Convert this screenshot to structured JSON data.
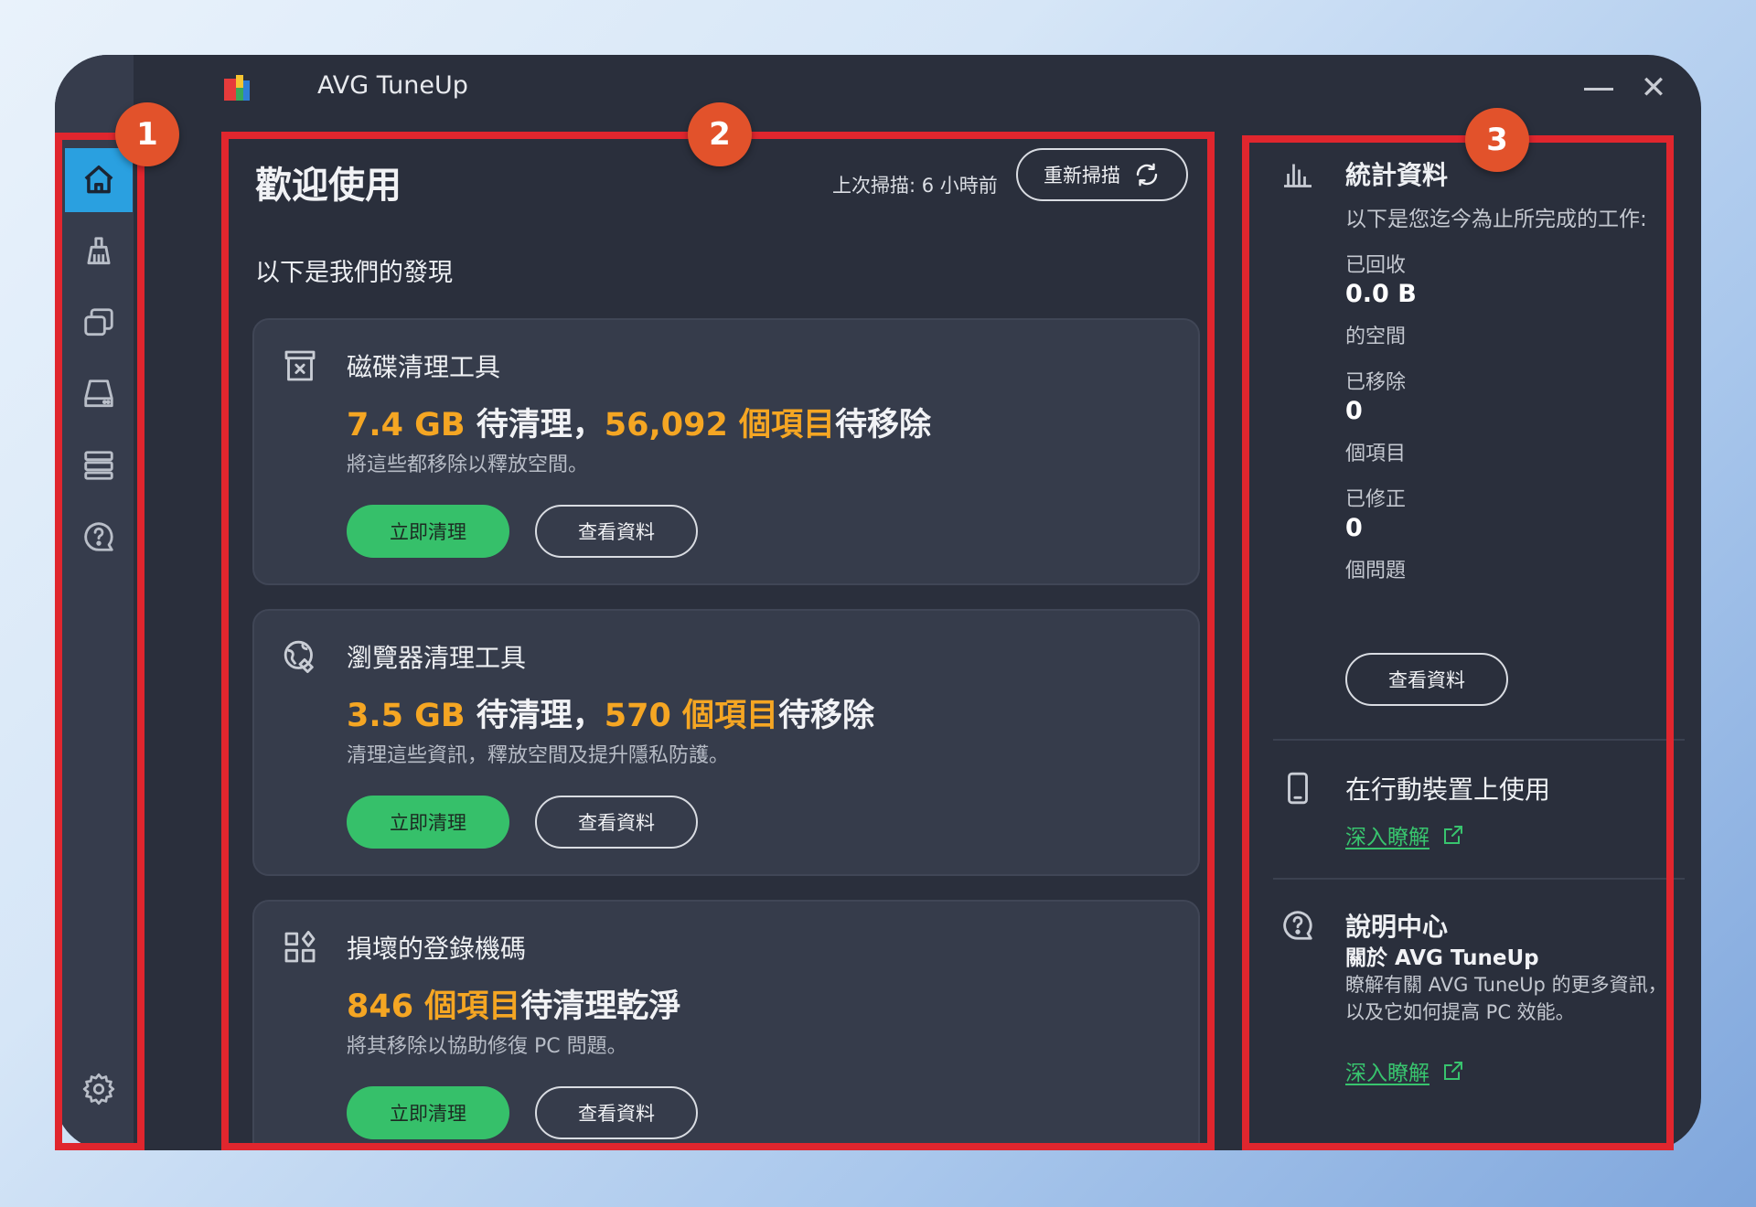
{
  "app": {
    "title": "AVG TuneUp"
  },
  "window_controls": {
    "close": "✕"
  },
  "sidebar": {
    "items": [
      {
        "name": "home",
        "icon": "home-icon",
        "active": true
      },
      {
        "name": "clean",
        "icon": "broom-icon"
      },
      {
        "name": "apps",
        "icon": "windows-stack-icon"
      },
      {
        "name": "drive",
        "icon": "drive-icon"
      },
      {
        "name": "registry",
        "icon": "database-icon"
      },
      {
        "name": "help",
        "icon": "help-icon"
      }
    ],
    "settings_icon": "gear-icon"
  },
  "main": {
    "welcome": "歡迎使用",
    "last_scan": "上次掃描: 6 小時前",
    "rescan_label": "重新掃描",
    "findings_label": "以下是我們的發現",
    "cards": [
      {
        "title": "磁碟清理工具",
        "icon": "archive-box-icon",
        "headline": {
          "a_hl": "7.4 GB",
          "a_txt": " 待清理，",
          "b_hl": "56,092 個項目",
          "b_txt": "待移除"
        },
        "desc": "將這些都移除以釋放空間。",
        "clean_label": "立即清理",
        "details_label": "查看資料"
      },
      {
        "title": "瀏覽器清理工具",
        "icon": "globe-broom-icon",
        "headline": {
          "a_hl": "3.5 GB",
          "a_txt": " 待清理，",
          "b_hl": "570 個項目",
          "b_txt": "待移除"
        },
        "desc": "清理這些資訊，釋放空間及提升隱私防護。",
        "clean_label": "立即清理",
        "details_label": "查看資料"
      },
      {
        "title": "損壞的登錄機碼",
        "icon": "registry-blocks-icon",
        "headline": {
          "a_hl": "846 個項目",
          "a_txt": "待清理乾淨",
          "b_hl": "",
          "b_txt": ""
        },
        "desc": "將其移除以協助修復 PC 問題。",
        "clean_label": "立即清理",
        "details_label": "查看資料"
      }
    ]
  },
  "stats": {
    "title": "統計資料",
    "intro": "以下是您迄今為止所完成的工作:",
    "items": [
      {
        "label": "已回收",
        "value": "0.0 B",
        "unit": "的空間"
      },
      {
        "label": "已移除",
        "value": "0",
        "unit": "個項目"
      },
      {
        "label": "已修正",
        "value": "0",
        "unit": "個問題"
      }
    ],
    "details_label": "查看資料"
  },
  "mobile": {
    "title": "在行動裝置上使用",
    "link": "深入瞭解"
  },
  "help": {
    "title": "說明中心",
    "subtitle": "關於 AVG TuneUp",
    "desc": "瞭解有關 AVG TuneUp 的更多資訊，以及它如何提高 PC 效能。",
    "link": "深入瞭解"
  },
  "annotations": {
    "badge1": "1",
    "badge2": "2",
    "badge3": "3"
  },
  "colors": {
    "accent": "#36c06a",
    "highlight": "#f5a623",
    "frame": "#e0262e",
    "badge": "#e2522b"
  }
}
